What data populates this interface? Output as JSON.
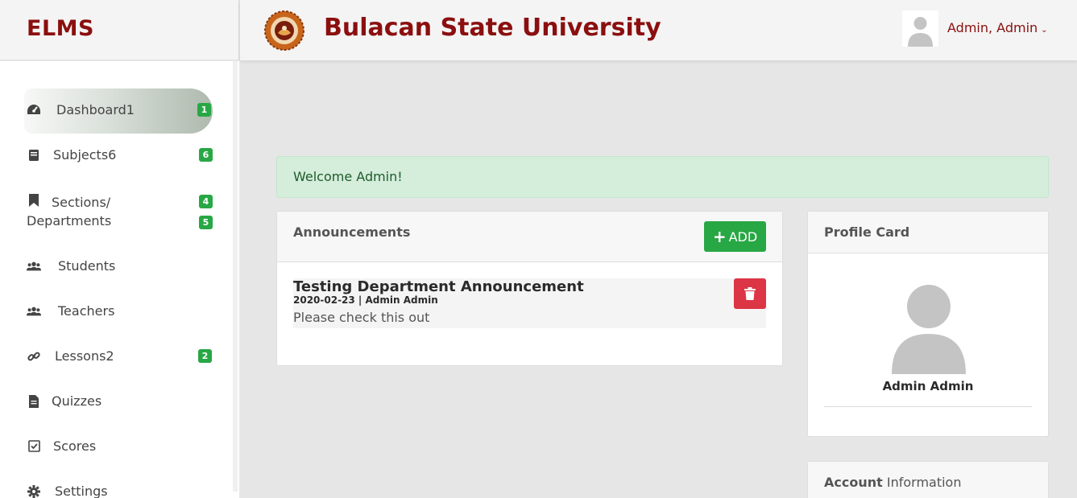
{
  "brand": {
    "name": "ELMS"
  },
  "header": {
    "university": "Bulacan State University",
    "user": "Admin, Admin"
  },
  "sidebar": {
    "items": [
      {
        "label": "Dashboard1",
        "badge": "1",
        "icon": "dashboard-icon"
      },
      {
        "label": "Subjects6",
        "badge": "6",
        "icon": "book-icon"
      },
      {
        "label": "Sections/",
        "label2": "Departments",
        "badge": "4",
        "badge2": "5",
        "icon": "bookmark-icon"
      },
      {
        "label": "Students",
        "icon": "users-icon"
      },
      {
        "label": "Teachers",
        "icon": "users-icon"
      },
      {
        "label": "Lessons2",
        "badge": "2",
        "icon": "link-icon"
      },
      {
        "label": "Quizzes",
        "icon": "file-icon"
      },
      {
        "label": "Scores",
        "icon": "check-square-icon"
      },
      {
        "label": "Settings",
        "icon": "gear-icon"
      }
    ]
  },
  "alert": {
    "text": "Welcome Admin!"
  },
  "announcements": {
    "title": "Announcements",
    "add_label": "ADD",
    "items": [
      {
        "title": "Testing Department Announcement",
        "meta": "2020-02-23 | Admin Admin",
        "body": "Please check this out"
      }
    ]
  },
  "profile": {
    "title": "Profile Card",
    "name": "Admin Admin"
  },
  "account": {
    "title_bold": "Account",
    "title_rest": " Information"
  },
  "colors": {
    "brand": "#8b0f0f",
    "success": "#28a745",
    "danger": "#dc3545"
  }
}
